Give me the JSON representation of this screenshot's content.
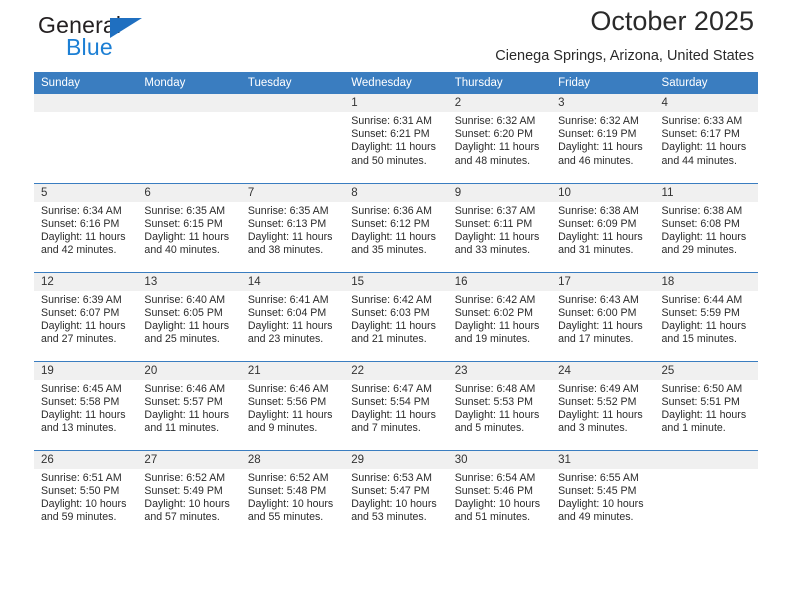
{
  "brand": {
    "name_part1": "General",
    "name_part2": "Blue",
    "accent_color": "#1f6fc0",
    "text_color": "#231f20"
  },
  "header": {
    "title": "October 2025",
    "subtitle": "Cienega Springs, Arizona, United States"
  },
  "calendar": {
    "header_bg": "#3a7dc0",
    "daynum_bg": "#f0f0f0",
    "weekday_headers": [
      "Sunday",
      "Monday",
      "Tuesday",
      "Wednesday",
      "Thursday",
      "Friday",
      "Saturday"
    ],
    "labels": {
      "sunrise": "Sunrise:",
      "sunset": "Sunset:",
      "daylight": "Daylight:"
    },
    "weeks": [
      [
        {
          "day": "",
          "blank": true
        },
        {
          "day": "",
          "blank": true
        },
        {
          "day": "",
          "blank": true
        },
        {
          "day": "1",
          "sunrise": "Sunrise: 6:31 AM",
          "sunset": "Sunset: 6:21 PM",
          "daylight_line1": "Daylight: 11 hours",
          "daylight_line2": "and 50 minutes."
        },
        {
          "day": "2",
          "sunrise": "Sunrise: 6:32 AM",
          "sunset": "Sunset: 6:20 PM",
          "daylight_line1": "Daylight: 11 hours",
          "daylight_line2": "and 48 minutes."
        },
        {
          "day": "3",
          "sunrise": "Sunrise: 6:32 AM",
          "sunset": "Sunset: 6:19 PM",
          "daylight_line1": "Daylight: 11 hours",
          "daylight_line2": "and 46 minutes."
        },
        {
          "day": "4",
          "sunrise": "Sunrise: 6:33 AM",
          "sunset": "Sunset: 6:17 PM",
          "daylight_line1": "Daylight: 11 hours",
          "daylight_line2": "and 44 minutes."
        }
      ],
      [
        {
          "day": "5",
          "sunrise": "Sunrise: 6:34 AM",
          "sunset": "Sunset: 6:16 PM",
          "daylight_line1": "Daylight: 11 hours",
          "daylight_line2": "and 42 minutes."
        },
        {
          "day": "6",
          "sunrise": "Sunrise: 6:35 AM",
          "sunset": "Sunset: 6:15 PM",
          "daylight_line1": "Daylight: 11 hours",
          "daylight_line2": "and 40 minutes."
        },
        {
          "day": "7",
          "sunrise": "Sunrise: 6:35 AM",
          "sunset": "Sunset: 6:13 PM",
          "daylight_line1": "Daylight: 11 hours",
          "daylight_line2": "and 38 minutes."
        },
        {
          "day": "8",
          "sunrise": "Sunrise: 6:36 AM",
          "sunset": "Sunset: 6:12 PM",
          "daylight_line1": "Daylight: 11 hours",
          "daylight_line2": "and 35 minutes."
        },
        {
          "day": "9",
          "sunrise": "Sunrise: 6:37 AM",
          "sunset": "Sunset: 6:11 PM",
          "daylight_line1": "Daylight: 11 hours",
          "daylight_line2": "and 33 minutes."
        },
        {
          "day": "10",
          "sunrise": "Sunrise: 6:38 AM",
          "sunset": "Sunset: 6:09 PM",
          "daylight_line1": "Daylight: 11 hours",
          "daylight_line2": "and 31 minutes."
        },
        {
          "day": "11",
          "sunrise": "Sunrise: 6:38 AM",
          "sunset": "Sunset: 6:08 PM",
          "daylight_line1": "Daylight: 11 hours",
          "daylight_line2": "and 29 minutes."
        }
      ],
      [
        {
          "day": "12",
          "sunrise": "Sunrise: 6:39 AM",
          "sunset": "Sunset: 6:07 PM",
          "daylight_line1": "Daylight: 11 hours",
          "daylight_line2": "and 27 minutes."
        },
        {
          "day": "13",
          "sunrise": "Sunrise: 6:40 AM",
          "sunset": "Sunset: 6:05 PM",
          "daylight_line1": "Daylight: 11 hours",
          "daylight_line2": "and 25 minutes."
        },
        {
          "day": "14",
          "sunrise": "Sunrise: 6:41 AM",
          "sunset": "Sunset: 6:04 PM",
          "daylight_line1": "Daylight: 11 hours",
          "daylight_line2": "and 23 minutes."
        },
        {
          "day": "15",
          "sunrise": "Sunrise: 6:42 AM",
          "sunset": "Sunset: 6:03 PM",
          "daylight_line1": "Daylight: 11 hours",
          "daylight_line2": "and 21 minutes."
        },
        {
          "day": "16",
          "sunrise": "Sunrise: 6:42 AM",
          "sunset": "Sunset: 6:02 PM",
          "daylight_line1": "Daylight: 11 hours",
          "daylight_line2": "and 19 minutes."
        },
        {
          "day": "17",
          "sunrise": "Sunrise: 6:43 AM",
          "sunset": "Sunset: 6:00 PM",
          "daylight_line1": "Daylight: 11 hours",
          "daylight_line2": "and 17 minutes."
        },
        {
          "day": "18",
          "sunrise": "Sunrise: 6:44 AM",
          "sunset": "Sunset: 5:59 PM",
          "daylight_line1": "Daylight: 11 hours",
          "daylight_line2": "and 15 minutes."
        }
      ],
      [
        {
          "day": "19",
          "sunrise": "Sunrise: 6:45 AM",
          "sunset": "Sunset: 5:58 PM",
          "daylight_line1": "Daylight: 11 hours",
          "daylight_line2": "and 13 minutes."
        },
        {
          "day": "20",
          "sunrise": "Sunrise: 6:46 AM",
          "sunset": "Sunset: 5:57 PM",
          "daylight_line1": "Daylight: 11 hours",
          "daylight_line2": "and 11 minutes."
        },
        {
          "day": "21",
          "sunrise": "Sunrise: 6:46 AM",
          "sunset": "Sunset: 5:56 PM",
          "daylight_line1": "Daylight: 11 hours",
          "daylight_line2": "and 9 minutes."
        },
        {
          "day": "22",
          "sunrise": "Sunrise: 6:47 AM",
          "sunset": "Sunset: 5:54 PM",
          "daylight_line1": "Daylight: 11 hours",
          "daylight_line2": "and 7 minutes."
        },
        {
          "day": "23",
          "sunrise": "Sunrise: 6:48 AM",
          "sunset": "Sunset: 5:53 PM",
          "daylight_line1": "Daylight: 11 hours",
          "daylight_line2": "and 5 minutes."
        },
        {
          "day": "24",
          "sunrise": "Sunrise: 6:49 AM",
          "sunset": "Sunset: 5:52 PM",
          "daylight_line1": "Daylight: 11 hours",
          "daylight_line2": "and 3 minutes."
        },
        {
          "day": "25",
          "sunrise": "Sunrise: 6:50 AM",
          "sunset": "Sunset: 5:51 PM",
          "daylight_line1": "Daylight: 11 hours",
          "daylight_line2": "and 1 minute."
        }
      ],
      [
        {
          "day": "26",
          "sunrise": "Sunrise: 6:51 AM",
          "sunset": "Sunset: 5:50 PM",
          "daylight_line1": "Daylight: 10 hours",
          "daylight_line2": "and 59 minutes."
        },
        {
          "day": "27",
          "sunrise": "Sunrise: 6:52 AM",
          "sunset": "Sunset: 5:49 PM",
          "daylight_line1": "Daylight: 10 hours",
          "daylight_line2": "and 57 minutes."
        },
        {
          "day": "28",
          "sunrise": "Sunrise: 6:52 AM",
          "sunset": "Sunset: 5:48 PM",
          "daylight_line1": "Daylight: 10 hours",
          "daylight_line2": "and 55 minutes."
        },
        {
          "day": "29",
          "sunrise": "Sunrise: 6:53 AM",
          "sunset": "Sunset: 5:47 PM",
          "daylight_line1": "Daylight: 10 hours",
          "daylight_line2": "and 53 minutes."
        },
        {
          "day": "30",
          "sunrise": "Sunrise: 6:54 AM",
          "sunset": "Sunset: 5:46 PM",
          "daylight_line1": "Daylight: 10 hours",
          "daylight_line2": "and 51 minutes."
        },
        {
          "day": "31",
          "sunrise": "Sunrise: 6:55 AM",
          "sunset": "Sunset: 5:45 PM",
          "daylight_line1": "Daylight: 10 hours",
          "daylight_line2": "and 49 minutes."
        },
        {
          "day": "",
          "blank": true
        }
      ]
    ]
  }
}
